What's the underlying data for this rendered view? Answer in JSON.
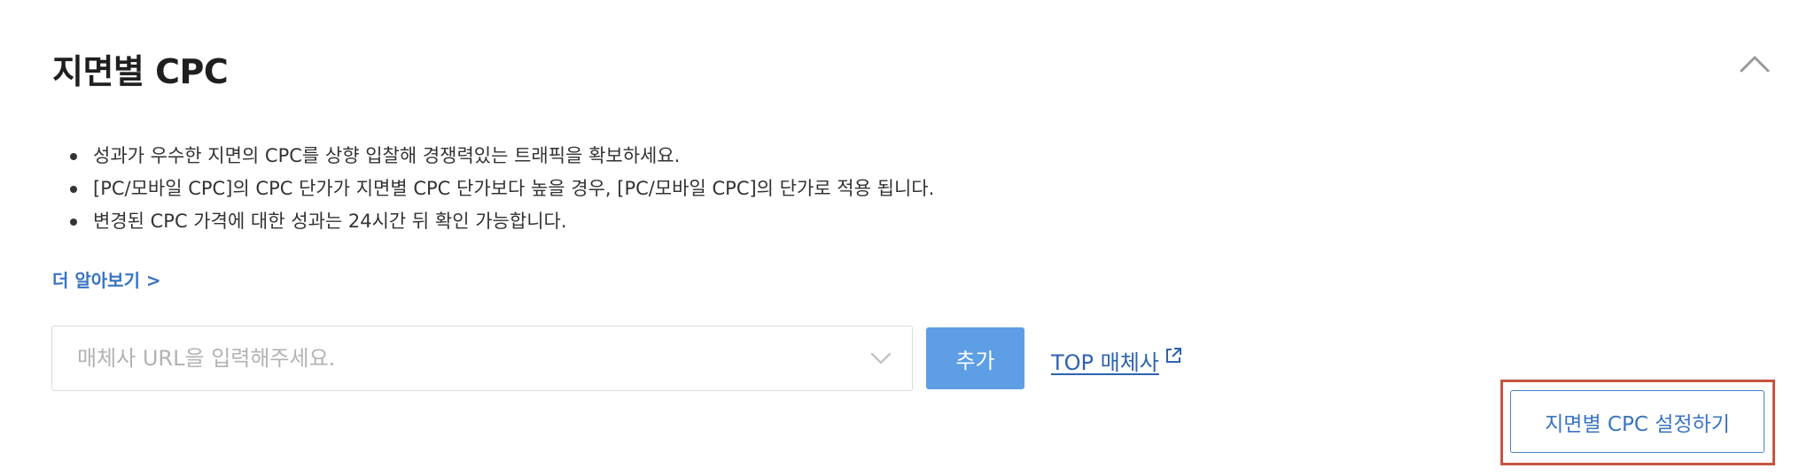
{
  "section": {
    "title": "지면별 CPC",
    "collapse_icon": "chevron-up-icon"
  },
  "notes": [
    "성과가 우수한 지면의 CPC를 상향 입찰해 경쟁력있는 트래픽을 확보하세요.",
    "[PC/모바일 CPC]의 CPC 단가가 지면별 CPC 단가보다 높을 경우, [PC/모바일 CPC]의 단가로 적용 됩니다.",
    "변경된 CPC 가격에 대한 성과는 24시간 뒤 확인 가능합니다."
  ],
  "learn_more": "더 알아보기 >",
  "url_input": {
    "placeholder": "매체사 URL을 입력해주세요.",
    "value": "",
    "icon": "chevron-down-icon"
  },
  "add_button": "추가",
  "top_media_link": {
    "label": "TOP 매체사",
    "icon": "external-link-icon"
  },
  "setting_button": "지면별 CPC 설정하기",
  "colors": {
    "primary_button": "#5d9ee4",
    "link": "#3a74c2",
    "highlight_border": "#c6553f"
  }
}
